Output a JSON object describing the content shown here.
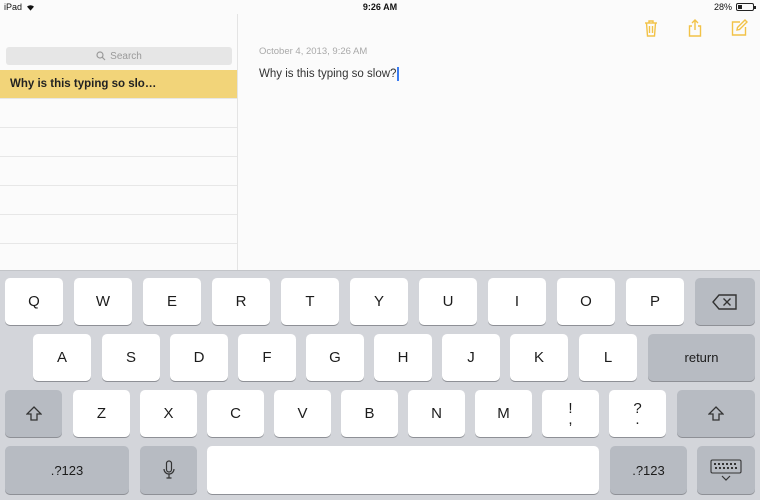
{
  "status_bar": {
    "device": "iPad",
    "time": "9:26 AM",
    "battery": "28%",
    "battery_level": 0.28
  },
  "sidebar": {
    "search_placeholder": "Search",
    "notes": [
      {
        "title": "Why is this typing so slo…",
        "selected": true
      }
    ]
  },
  "note": {
    "date": "October 4, 2013, 9:26 AM",
    "body": "Why is this typing so slow?"
  },
  "toolbar": {
    "icons": [
      "trash-icon",
      "share-icon",
      "compose-icon"
    ]
  },
  "colors": {
    "accent": "#f2c247",
    "selected_row": "#f2d479",
    "caret": "#3b7cf0",
    "keyboard_bg": "#d3d5da"
  },
  "keyboard": {
    "row1": [
      "Q",
      "W",
      "E",
      "R",
      "T",
      "Y",
      "U",
      "I",
      "O",
      "P"
    ],
    "row2": [
      "A",
      "S",
      "D",
      "F",
      "G",
      "H",
      "J",
      "K",
      "L"
    ],
    "row3": [
      "Z",
      "X",
      "C",
      "V",
      "B",
      "N",
      "M"
    ],
    "punct1_top": "!",
    "punct1_bottom": ",",
    "punct2_top": "?",
    "punct2_bottom": ".",
    "return_label": "return",
    "numbers_label": ".?123"
  }
}
